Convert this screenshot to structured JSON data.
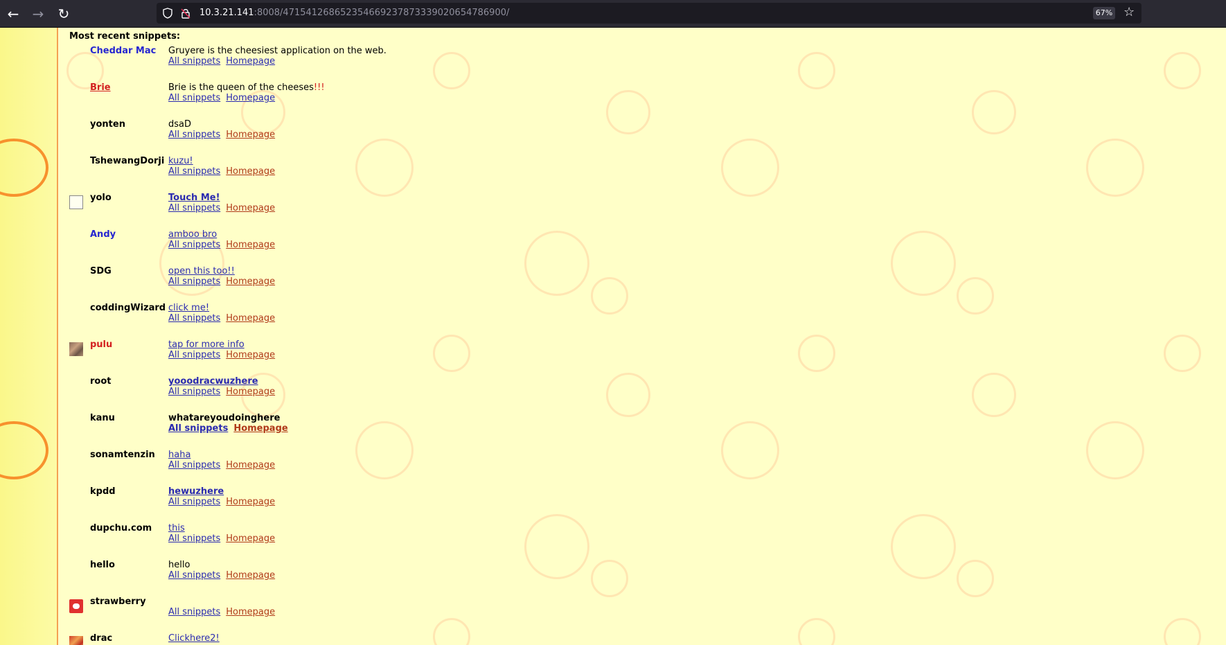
{
  "browser": {
    "url_host": "10.3.21.141",
    "url_rest": ":8008/471541268652354669237873339020654786900/",
    "zoom": "67%"
  },
  "heading": "Most recent snippets:",
  "link_labels": {
    "all": "All snippets",
    "home": "Homepage"
  },
  "snippets": [
    {
      "user": "Cheddar Mac",
      "text": "Gruyere is the cheesiest application on the web."
    },
    {
      "user": "Brie",
      "text": "Brie is the queen of the cheeses",
      "text_extra": "!!!"
    },
    {
      "user": "yonten",
      "text": "dsaD"
    },
    {
      "user": "TshewangDorji",
      "text": "kuzu!"
    },
    {
      "user": "yolo",
      "text": "Touch Me!"
    },
    {
      "user": "Andy",
      "text": "amboo bro"
    },
    {
      "user": "SDG",
      "text": "open this too!!"
    },
    {
      "user": "coddingWizard",
      "text": "click me!"
    },
    {
      "user": "pulu",
      "text": "tap for more info"
    },
    {
      "user": "root",
      "text": "yooodracwuzhere"
    },
    {
      "user": "kanu",
      "text": "whatareyoudoinghere"
    },
    {
      "user": "sonamtenzin",
      "text": "haha"
    },
    {
      "user": "kpdd",
      "text": "hewuzhere"
    },
    {
      "user": "dupchu.com",
      "text": "this"
    },
    {
      "user": "hello",
      "text": "hello"
    },
    {
      "user": "strawberry",
      "text": ""
    },
    {
      "user": "drac",
      "text": "Clickhere2!"
    }
  ]
}
